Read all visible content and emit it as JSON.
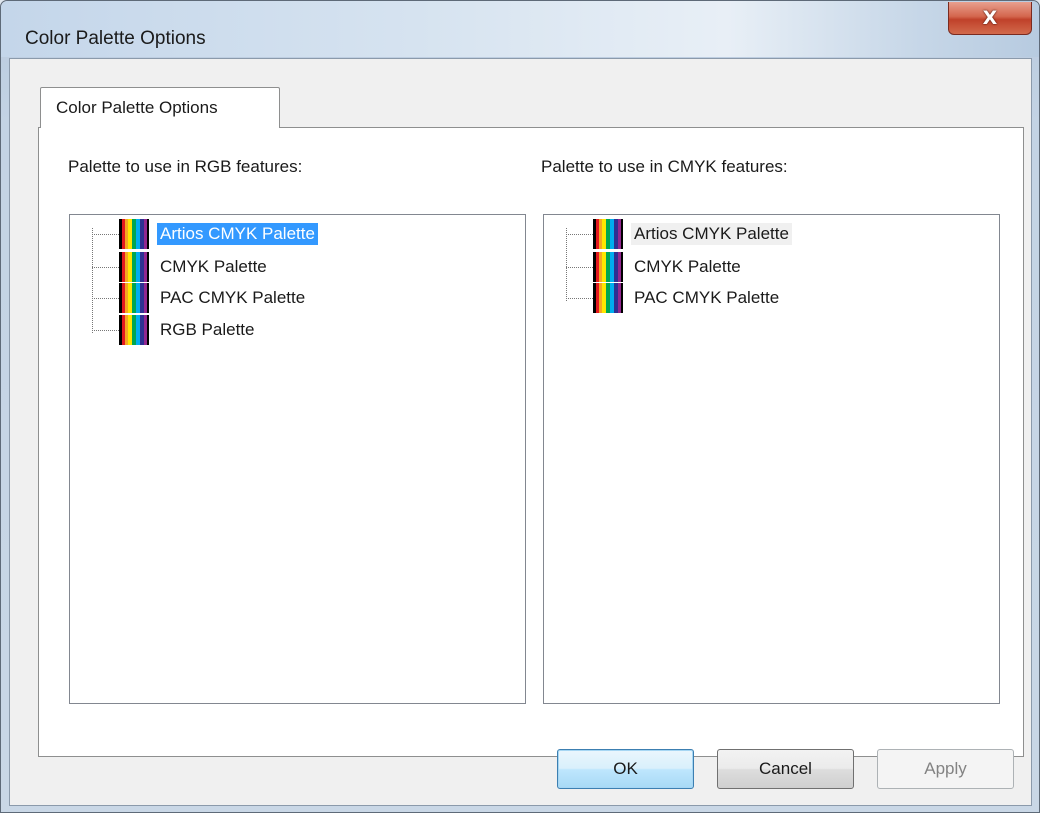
{
  "window": {
    "title": "Color Palette Options",
    "close_label": "X"
  },
  "tabs": [
    {
      "label": "Color Palette Options"
    }
  ],
  "rgb_group": {
    "label": "Palette to use in RGB features:",
    "items": [
      {
        "label": "Artios CMYK Palette",
        "selected": true
      },
      {
        "label": "CMYK Palette"
      },
      {
        "label": "PAC CMYK Palette"
      },
      {
        "label": "RGB Palette"
      }
    ]
  },
  "cmyk_group": {
    "label": "Palette to use in CMYK features:",
    "items": [
      {
        "label": "Artios CMYK Palette",
        "selected": true
      },
      {
        "label": "CMYK Palette"
      },
      {
        "label": "PAC CMYK Palette"
      }
    ]
  },
  "buttons": {
    "ok": "OK",
    "cancel": "Cancel",
    "apply": "Apply"
  },
  "icons": {
    "palette": "palette-swatch-icon",
    "close": "close-icon"
  },
  "colors": {
    "selection": "#3399ff",
    "close_button": "#c9452c"
  }
}
